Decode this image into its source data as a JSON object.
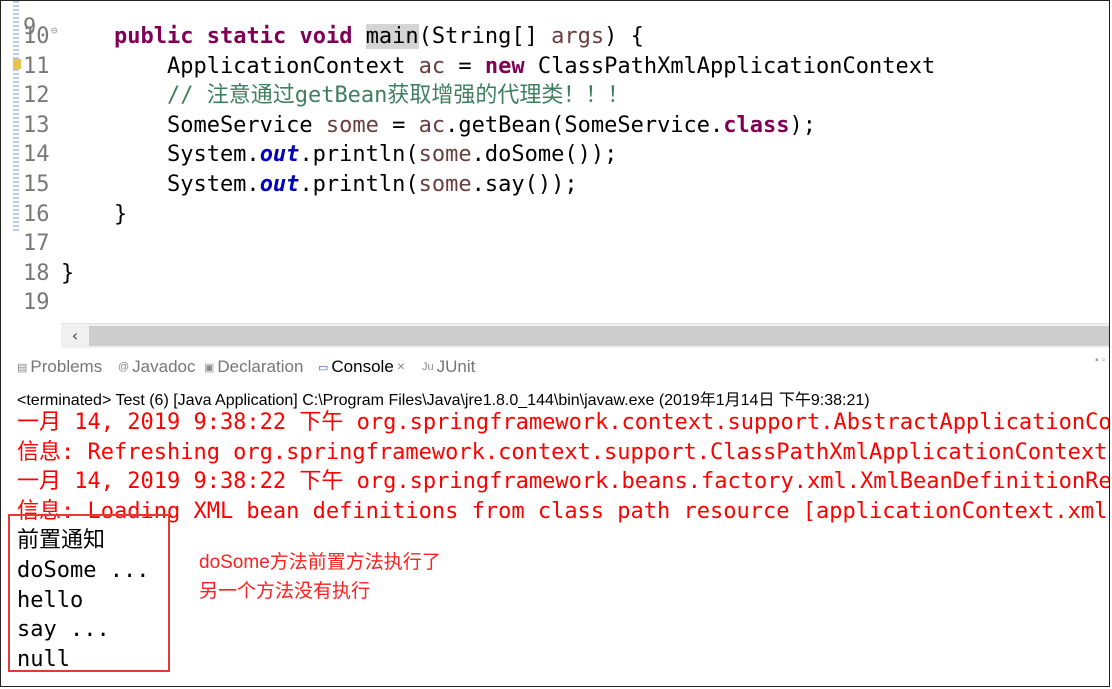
{
  "editor": {
    "top_partial_line_number": "9",
    "lines": [
      {
        "num": "10",
        "segments": [
          {
            "text": "    ",
            "cls": ""
          },
          {
            "text": "public",
            "cls": "kw"
          },
          {
            "text": " ",
            "cls": ""
          },
          {
            "text": "static",
            "cls": "kw"
          },
          {
            "text": " ",
            "cls": ""
          },
          {
            "text": "void",
            "cls": "kw"
          },
          {
            "text": " ",
            "cls": ""
          },
          {
            "text": "main",
            "cls": "hl"
          },
          {
            "text": "(String[] ",
            "cls": ""
          },
          {
            "text": "args",
            "cls": "var"
          },
          {
            "text": ") {",
            "cls": ""
          }
        ]
      },
      {
        "num": "11",
        "segments": [
          {
            "text": "        ApplicationContext ",
            "cls": ""
          },
          {
            "text": "ac",
            "cls": "var"
          },
          {
            "text": " = ",
            "cls": ""
          },
          {
            "text": "new",
            "cls": "kw"
          },
          {
            "text": " ClassPathXmlApplicationContext",
            "cls": ""
          }
        ]
      },
      {
        "num": "12",
        "segments": [
          {
            "text": "        ",
            "cls": ""
          },
          {
            "text": "// 注意通过getBean获取增强的代理类！！！",
            "cls": "cm"
          }
        ]
      },
      {
        "num": "13",
        "segments": [
          {
            "text": "        SomeService ",
            "cls": ""
          },
          {
            "text": "some",
            "cls": "var"
          },
          {
            "text": " = ",
            "cls": ""
          },
          {
            "text": "ac",
            "cls": "var"
          },
          {
            "text": ".getBean(SomeService.",
            "cls": ""
          },
          {
            "text": "class",
            "cls": "kw"
          },
          {
            "text": ");",
            "cls": ""
          }
        ]
      },
      {
        "num": "14",
        "segments": [
          {
            "text": "        System.",
            "cls": ""
          },
          {
            "text": "out",
            "cls": "sf"
          },
          {
            "text": ".println(",
            "cls": ""
          },
          {
            "text": "some",
            "cls": "var"
          },
          {
            "text": ".doSome());",
            "cls": ""
          }
        ]
      },
      {
        "num": "15",
        "segments": [
          {
            "text": "        System.",
            "cls": ""
          },
          {
            "text": "out",
            "cls": "sf"
          },
          {
            "text": ".println(",
            "cls": ""
          },
          {
            "text": "some",
            "cls": "var"
          },
          {
            "text": ".say());",
            "cls": ""
          }
        ]
      },
      {
        "num": "16",
        "segments": [
          {
            "text": "    }",
            "cls": ""
          }
        ]
      },
      {
        "num": "17",
        "segments": [
          {
            "text": "",
            "cls": ""
          }
        ]
      },
      {
        "num": "18",
        "segments": [
          {
            "text": "}",
            "cls": ""
          }
        ]
      },
      {
        "num": "19",
        "segments": [
          {
            "text": "",
            "cls": ""
          }
        ]
      }
    ],
    "fold_marker": "⊖",
    "scroll_left_glyph": "‹"
  },
  "views": {
    "tabs": [
      {
        "label": "Problems",
        "icon": "problems-icon",
        "glyph": "▤",
        "active": false
      },
      {
        "label": "Javadoc",
        "icon": "javadoc-icon",
        "glyph": "@",
        "active": false
      },
      {
        "label": "Declaration",
        "icon": "declaration-icon",
        "glyph": "▣",
        "active": false
      },
      {
        "label": "Console",
        "icon": "console-icon",
        "glyph": "▭",
        "active": true
      },
      {
        "label": "JUnit",
        "icon": "junit-icon",
        "glyph": "Ju",
        "active": false
      }
    ],
    "close_glyph": "✕",
    "view_menu_glyph": "▪ ▫"
  },
  "console": {
    "header": "<terminated> Test (6) [Java Application] C:\\Program Files\\Java\\jre1.8.0_144\\bin\\javaw.exe (2019年1月14日 下午9:38:21)",
    "lines": [
      {
        "text": "一月 14, 2019 9:38:22 下午 org.springframework.context.support.AbstractApplicationContext",
        "err": true
      },
      {
        "text": "信息: Refreshing org.springframework.context.support.ClassPathXmlApplicationContext",
        "err": true
      },
      {
        "text": "一月 14, 2019 9:38:22 下午 org.springframework.beans.factory.xml.XmlBeanDefinitionReader",
        "err": true
      },
      {
        "text": "信息: Loading XML bean definitions from class path resource [applicationContext.xml]",
        "err": true
      },
      {
        "text": "前置通知",
        "err": false
      },
      {
        "text": "doSome ...",
        "err": false
      },
      {
        "text": "hello",
        "err": false
      },
      {
        "text": "say ...",
        "err": false
      },
      {
        "text": "null",
        "err": false
      }
    ]
  },
  "annotation": {
    "line1": "doSome方法前置方法执行了",
    "line2": "另一个方法没有执行",
    "color": "#ff2020"
  }
}
